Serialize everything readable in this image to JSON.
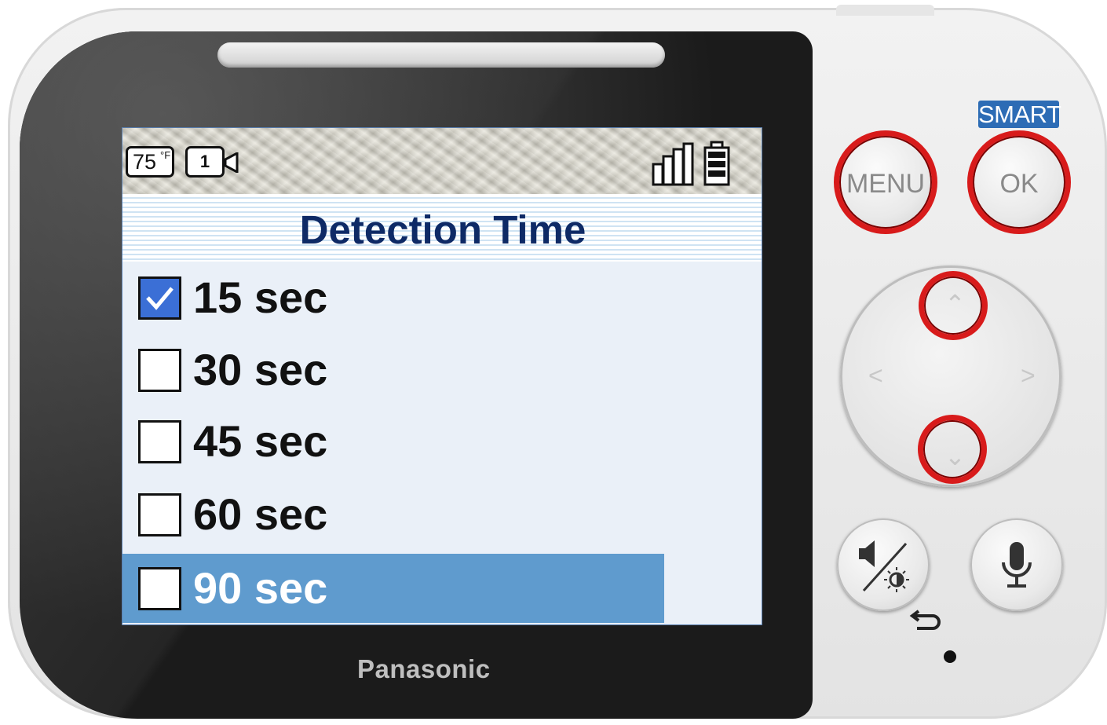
{
  "device": {
    "brand": "Panasonic"
  },
  "status": {
    "temperature_value": "75",
    "temperature_unit": "°F",
    "camera_number": "1",
    "signal_icon": "signal-bars-icon",
    "battery_icon": "battery-full-icon"
  },
  "screen": {
    "title": "Detection Time",
    "options": [
      {
        "label": "15 sec",
        "checked": true
      },
      {
        "label": "30 sec",
        "checked": false
      },
      {
        "label": "45 sec",
        "checked": false
      },
      {
        "label": "60 sec",
        "checked": false
      },
      {
        "label": "90 sec",
        "checked": false,
        "highlighted": true
      }
    ]
  },
  "buttons": {
    "menu_label": "MENU",
    "ok_label": "OK",
    "smart_label": "SMART",
    "highlight_color": "#d81b1b",
    "selection_color": "#5f9bce",
    "title_color": "#0e2a66"
  }
}
